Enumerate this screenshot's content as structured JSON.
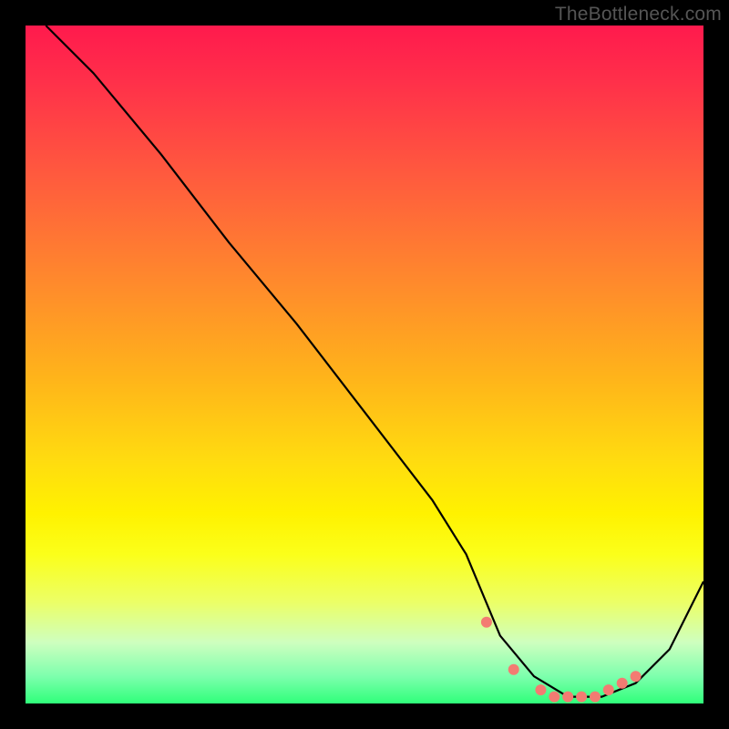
{
  "watermark": "TheBottleneck.com",
  "colors": {
    "frame_bg": "#000000",
    "gradient_top": "#ff1a4d",
    "gradient_bottom": "#2fff7a",
    "curve_stroke": "#000000",
    "marker_fill": "#f37b72"
  },
  "chart_data": {
    "type": "line",
    "title": "",
    "xlabel": "",
    "ylabel": "",
    "xlim": [
      0,
      100
    ],
    "ylim": [
      0,
      100
    ],
    "x": [
      3,
      10,
      20,
      30,
      40,
      50,
      60,
      65,
      70,
      75,
      80,
      85,
      90,
      95,
      100
    ],
    "values": [
      100,
      93,
      81,
      68,
      56,
      43,
      30,
      22,
      10,
      4,
      1,
      1,
      3,
      8,
      18
    ],
    "markers": {
      "x": [
        68,
        72,
        76,
        78,
        80,
        82,
        84,
        86,
        88,
        90
      ],
      "y": [
        12,
        5,
        2,
        1,
        1,
        1,
        1,
        2,
        3,
        4
      ]
    }
  }
}
